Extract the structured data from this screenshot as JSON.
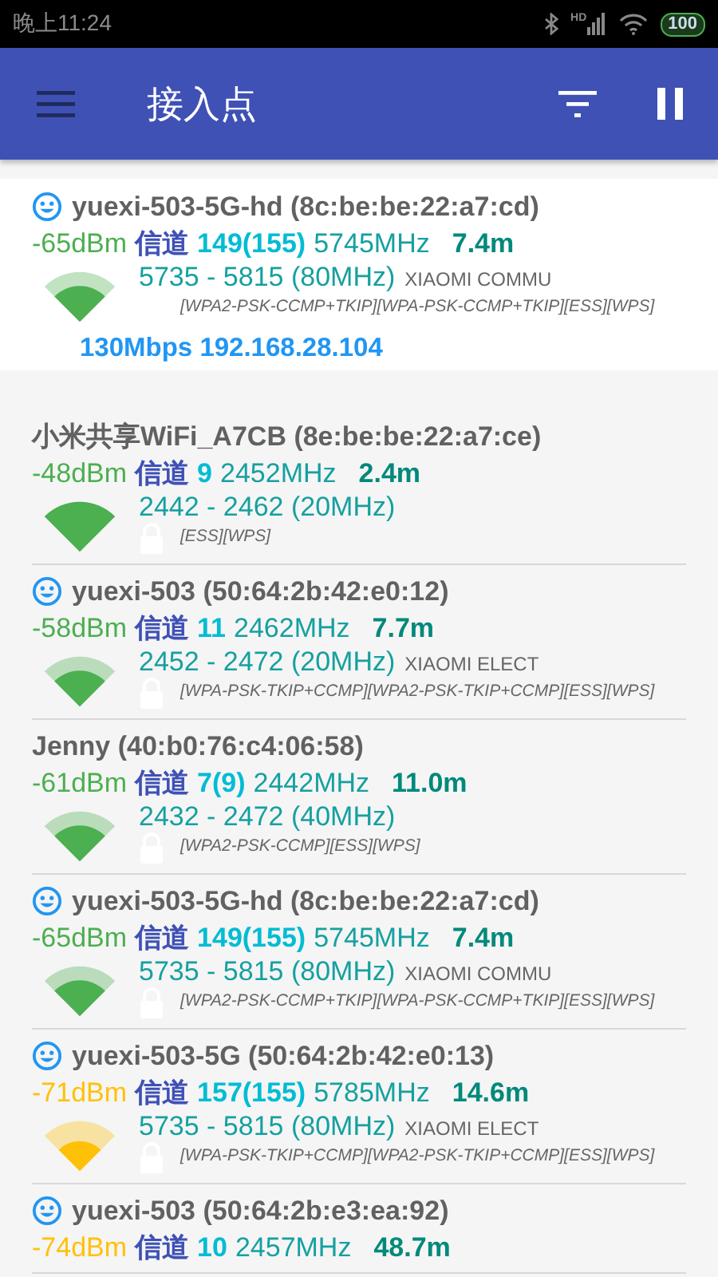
{
  "status_bar": {
    "time": "晚上11:24",
    "network": "HD",
    "battery": "100"
  },
  "app_bar": {
    "title": "接入点"
  },
  "access_points": [
    {
      "name": "yuexi-503-5G-hd (8c:be:be:22:a7:cd)",
      "known": true,
      "connected": true,
      "rssi": "-65dBm",
      "color": "#4caf50",
      "channel_label": "信道",
      "channel": "149(155)",
      "frequency": "5745MHz",
      "distance": "7.4m",
      "range": "5735 - 5815 (80MHz)",
      "vendor": "XIAOMI COMMU",
      "capabilities": "[WPA2-PSK-CCMP+TKIP][WPA-PSK-CCMP+TKIP][ESS][WPS]",
      "signal_icon": {
        "kind": "high"
      },
      "link_info": "130Mbps 192.168.28.104"
    },
    {
      "name": "小米共享WiFi_A7CB (8e:be:be:22:a7:ce)",
      "known": false,
      "connected": false,
      "rssi": "-48dBm",
      "color": "#4caf50",
      "channel_label": "信道",
      "channel": "9",
      "frequency": "2452MHz",
      "distance": "2.4m",
      "range": "2442 - 2462 (20MHz)",
      "capabilities": "[ESS][WPS]",
      "signal_icon": {
        "kind": "full"
      }
    },
    {
      "name": "yuexi-503 (50:64:2b:42:e0:12)",
      "known": true,
      "connected": false,
      "rssi": "-58dBm",
      "color": "#4caf50",
      "channel_label": "信道",
      "channel": "11",
      "frequency": "2462MHz",
      "distance": "7.7m",
      "range": "2452 - 2472 (20MHz)",
      "vendor": "XIAOMI ELECT",
      "capabilities": "[WPA-PSK-TKIP+CCMP][WPA2-PSK-TKIP+CCMP][ESS][WPS]",
      "signal_icon": {
        "kind": "high"
      }
    },
    {
      "name": "Jenny (40:b0:76:c4:06:58)",
      "known": false,
      "connected": false,
      "rssi": "-61dBm",
      "color": "#4caf50",
      "channel_label": "信道",
      "channel": "7(9)",
      "frequency": "2442MHz",
      "distance": "11.0m",
      "range": "2432 - 2472 (40MHz)",
      "capabilities": "[WPA2-PSK-CCMP][ESS][WPS]",
      "signal_icon": {
        "kind": "high"
      }
    },
    {
      "name": "yuexi-503-5G-hd (8c:be:be:22:a7:cd)",
      "known": true,
      "connected": false,
      "rssi": "-65dBm",
      "color": "#4caf50",
      "channel_label": "信道",
      "channel": "149(155)",
      "frequency": "5745MHz",
      "distance": "7.4m",
      "range": "5735 - 5815 (80MHz)",
      "vendor": "XIAOMI COMMU",
      "capabilities": "[WPA2-PSK-CCMP+TKIP][WPA-PSK-CCMP+TKIP][ESS][WPS]",
      "signal_icon": {
        "kind": "high"
      }
    },
    {
      "name": "yuexi-503-5G (50:64:2b:42:e0:13)",
      "known": true,
      "connected": false,
      "rssi": "-71dBm",
      "color": "#ffc107",
      "channel_label": "信道",
      "channel": "157(155)",
      "frequency": "5785MHz",
      "distance": "14.6m",
      "range": "5735 - 5815 (80MHz)",
      "vendor": "XIAOMI ELECT",
      "capabilities": "[WPA-PSK-TKIP+CCMP][WPA2-PSK-TKIP+CCMP][ESS][WPS]",
      "signal_icon": {
        "kind": "medium"
      }
    },
    {
      "name": "yuexi-503 (50:64:2b:e3:ea:92)",
      "known": true,
      "connected": false,
      "rssi": "-74dBm",
      "color": "#ffc107",
      "channel_label": "信道",
      "channel": "10",
      "frequency": "2457MHz",
      "distance": "48.7m"
    }
  ]
}
